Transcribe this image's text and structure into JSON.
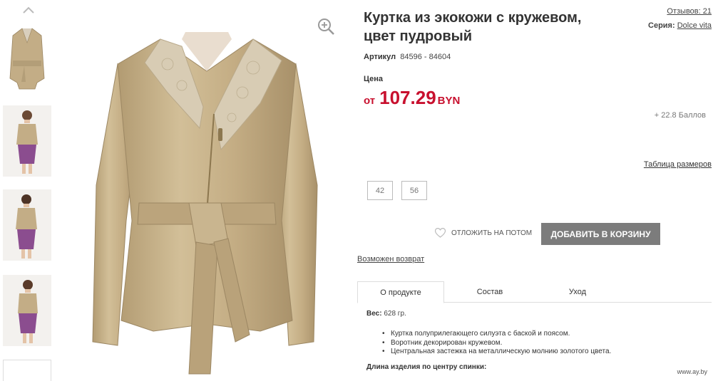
{
  "product": {
    "title": "Куртка из экокожи с кружевом, цвет пудровый",
    "reviews_label": "Отзывов: 21",
    "series_label": "Серия:",
    "series_value": "Dolce vita",
    "article_label": "Артикул",
    "article_value": "84596 - 84604",
    "price_label": "Цена",
    "price_prefix": "от",
    "price_value": "107.29",
    "price_currency": "BYN",
    "points": "+ 22.8 Баллов",
    "size_table_label": "Таблица размеров",
    "sizes": [
      "42",
      "56"
    ],
    "later_label": "ОТЛОЖИТЬ НА ПОТОМ",
    "add_to_cart_label": "ДОБАВИТЬ В КОРЗИНУ",
    "return_label": "Возможен возврат"
  },
  "tabs": [
    "О продукте",
    "Состав",
    "Уход"
  ],
  "details": {
    "weight_label": "Вес:",
    "weight_value": "628 гр.",
    "bullets": [
      "Куртка полуприлегающего силуэта с баской и поясом.",
      "Воротник декорирован кружевом.",
      "Центральная застежка на металлическую молнию золотого цвета."
    ],
    "length_label": "Длина изделия по центру спинки:"
  },
  "watermark": "www.ay.by",
  "icons": {
    "up": "chevron-up-icon",
    "zoom": "zoom-in-icon",
    "heart": "heart-icon"
  },
  "colors": {
    "price": "#c8102e",
    "button": "#7c7c7c",
    "jacket": "#c3ad86"
  }
}
